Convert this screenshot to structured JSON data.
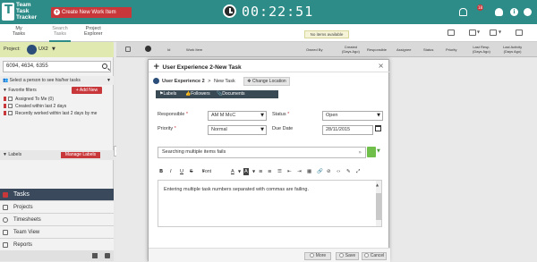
{
  "app": {
    "logo_text": "Team\nTask\nTracker",
    "create_button": "Create New Work Item",
    "timer": "00:22:51",
    "notification_count": "18"
  },
  "nav": {
    "tabs": [
      "My\nTasks",
      "Search\nTasks",
      "Project\nExplorer"
    ],
    "no_items": "No items available"
  },
  "sidebar": {
    "project_label": "Project:",
    "project_value": "UX2",
    "search_value": "6094, 4634, 6355",
    "select_person": "Select a person to see his/her tasks",
    "favorite_filters": "Favorite filters",
    "add_new": "Add New",
    "filters": [
      "Assigned To Me (0)",
      "Created within last 2 days",
      "Recently worked within last 2 days by me"
    ],
    "labels": "Labels",
    "manage_labels": "Manage Labels",
    "modules": [
      "Tasks",
      "Projects",
      "Timesheets",
      "Team View",
      "Reports"
    ]
  },
  "table": {
    "headers": [
      "Id",
      "Work Item",
      "Owned By",
      "Created\n(Days Ago)",
      "Responsible",
      "Assignee",
      "Status",
      "Priority",
      "Last Resp.\n(Days Ago)",
      "Last Activity\n(Days Ago)"
    ]
  },
  "modal": {
    "title": "User Experience 2-New Task",
    "breadcrumb_project": "User Experience 2",
    "breadcrumb_sep": ">",
    "breadcrumb_current": "New Task",
    "change_location": "Change Location",
    "actions": [
      "Labels",
      "Followers",
      "Documents & Screenshots"
    ],
    "responsible_label": "Responsible",
    "responsible_value": "AM M McC",
    "status_label": "Status",
    "status_value": "Open",
    "priority_label": "Priority",
    "priority_value": "Normal",
    "due_date_label": "Due Date",
    "due_date_value": "28/11/2015",
    "subject": "Searching multiple items fails",
    "font_sizes": "Font Sizes",
    "body_text": "Entering multiple task numbers separated with commas are failing.",
    "footer_buttons": [
      "More",
      "Save",
      "Cancel"
    ]
  },
  "colors": {
    "brand": "#2d8c87",
    "accent_red": "#c8383b",
    "dark_nav": "#3a4a5c"
  }
}
